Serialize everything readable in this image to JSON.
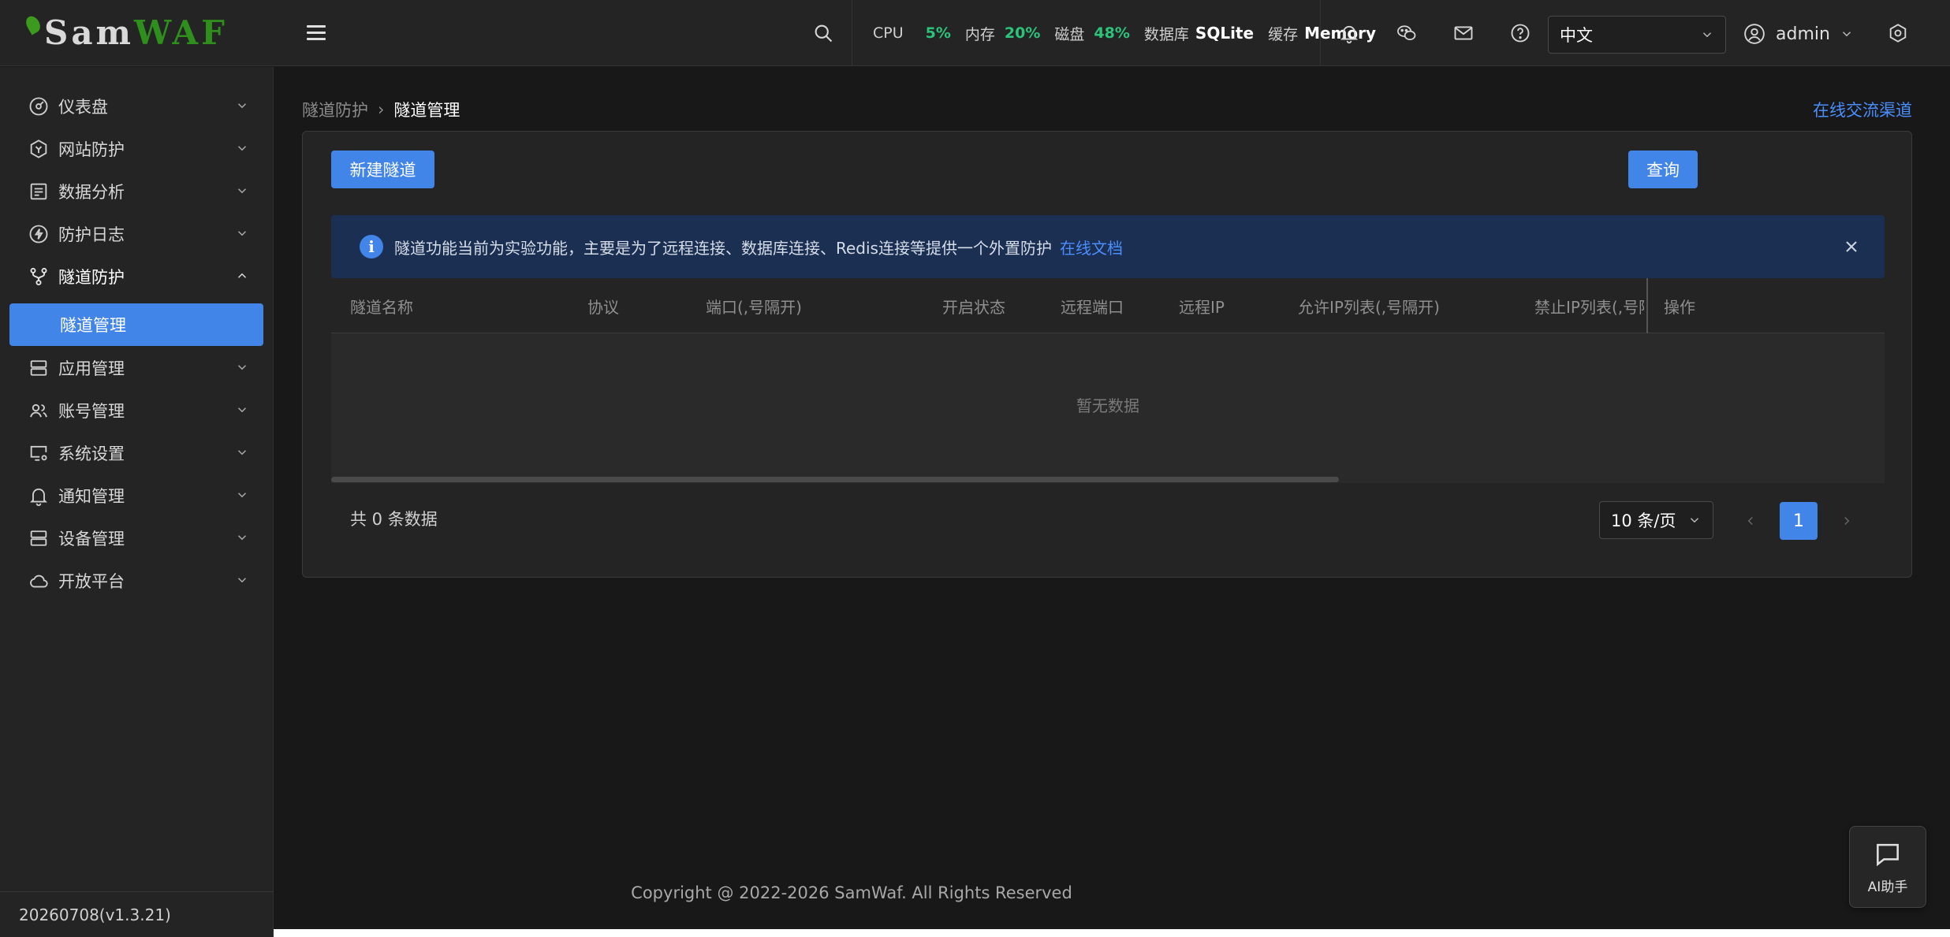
{
  "logo": {
    "part1": "Sam",
    "part2": "WAF"
  },
  "status": {
    "cpu_label": "CPU",
    "cpu_value": "5%",
    "mem_label": "内存",
    "mem_value": "20%",
    "disk_label": "磁盘",
    "disk_value": "48%",
    "db_label": "数据库",
    "db_value": "SQLite",
    "cache_label": "缓存",
    "cache_value": "Memory"
  },
  "header": {
    "language": "中文",
    "user": "admin"
  },
  "sidebar": {
    "items": [
      {
        "label": "仪表盘",
        "icon": "dashboard-icon"
      },
      {
        "label": "网站防护",
        "icon": "shield-icon"
      },
      {
        "label": "数据分析",
        "icon": "report-icon"
      },
      {
        "label": "防护日志",
        "icon": "bolt-icon"
      },
      {
        "label": "隧道防护",
        "icon": "tunnel-icon"
      },
      {
        "label": "应用管理",
        "icon": "server-icon"
      },
      {
        "label": "账号管理",
        "icon": "users-icon"
      },
      {
        "label": "系统设置",
        "icon": "monitor-gear-icon"
      },
      {
        "label": "通知管理",
        "icon": "bell-icon"
      },
      {
        "label": "设备管理",
        "icon": "server-icon"
      },
      {
        "label": "开放平台",
        "icon": "cloud-icon"
      }
    ],
    "sub_item": "隧道管理",
    "version": "20260708(v1.3.21)"
  },
  "breadcrumb": {
    "parent": "隧道防护",
    "current": "隧道管理"
  },
  "online_link": "在线交流渠道",
  "toolbar": {
    "new_label": "新建隧道",
    "query_label": "查询"
  },
  "alert": {
    "text": "隧道功能当前为实验功能，主要是为了远程连接、数据库连接、Redis连接等提供一个外置防护",
    "link": "在线文档"
  },
  "table": {
    "columns": [
      "隧道名称",
      "协议",
      "端口(,号隔开)",
      "开启状态",
      "远程端口",
      "远程IP",
      "允许IP列表(,号隔开)",
      "禁止IP列表(,号隔开)",
      "操作"
    ],
    "empty_text": "暂无数据"
  },
  "pagination": {
    "total_text": "共 0 条数据",
    "page_size": "10 条/页",
    "current_page": "1"
  },
  "footer": "Copyright @ 2022-2026 SamWaf. All Rights Reserved",
  "ai_button": "AI助手",
  "colors": {
    "primary": "#4285e8",
    "status_green": "#2cc37a",
    "brand_green": "#2f8f1c"
  }
}
